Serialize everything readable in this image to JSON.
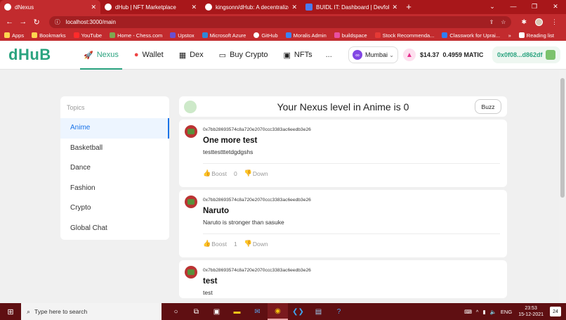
{
  "browser": {
    "tabs": [
      {
        "title": "dNexus",
        "active": true
      },
      {
        "title": "dHub | NFT Marketplace",
        "active": false
      },
      {
        "title": "kingsonn/dHub: A decentralized",
        "active": false
      },
      {
        "title": "BUIDL IT: Dashboard | Devfolio",
        "active": false
      }
    ],
    "url": "localhost:3000/main",
    "bookmarks": [
      "Apps",
      "Bookmarks",
      "YouTube",
      "Home - Chess.com",
      "Upstox",
      "Microsoft Azure",
      "GitHub",
      "Moralis Admin",
      "buildspace",
      "Stock Recommenda...",
      "Classwork for Uprai..."
    ],
    "reading_list": "Reading list",
    "more_bookmarks": "»"
  },
  "app": {
    "logo": "dHuB",
    "menu": [
      {
        "label": "Nexus",
        "icon": "rocket-icon",
        "active": true
      },
      {
        "label": "Wallet",
        "icon": "wallet-icon",
        "active": false
      },
      {
        "label": "Dex",
        "icon": "building-icon",
        "active": false
      },
      {
        "label": "Buy Crypto",
        "icon": "card-icon",
        "active": false
      },
      {
        "label": "NFTs",
        "icon": "image-icon",
        "active": false
      }
    ],
    "more": "...",
    "chain": "Mumbai",
    "balance_usd": "$14.37",
    "balance_matic": "0.4959 MATIC",
    "account": "0x0f08...d862df"
  },
  "topics": {
    "heading": "Topics",
    "items": [
      "Anime",
      "Basketball",
      "Dance",
      "Fashion",
      "Crypto",
      "Global Chat"
    ],
    "active": "Anime"
  },
  "feed": {
    "level_text": "Your Nexus level in Anime is 0",
    "buzz_label": "Buzz",
    "posts": [
      {
        "address": "0x7bb28693574c8a720e2070ccc3383ac6eedb3e26",
        "title": "One more test",
        "body": "testtestttetdgdgshs",
        "boost_label": "Boost",
        "count": "0",
        "down_label": "Down"
      },
      {
        "address": "0x7bb28693574c8a720e2070ccc3383ac6eedb3e26",
        "title": "Naruto",
        "body": "Naruto is stronger than sasuke",
        "boost_label": "Boost",
        "count": "1",
        "down_label": "Down"
      },
      {
        "address": "0x7bb28693574c8a720e2070ccc3383ac6eedb3e26",
        "title": "test",
        "body": "test"
      }
    ]
  },
  "taskbar": {
    "search_placeholder": "Type here to search",
    "lang": "ENG",
    "time": "23:53",
    "date": "15-12-2021",
    "notifications": "24"
  }
}
